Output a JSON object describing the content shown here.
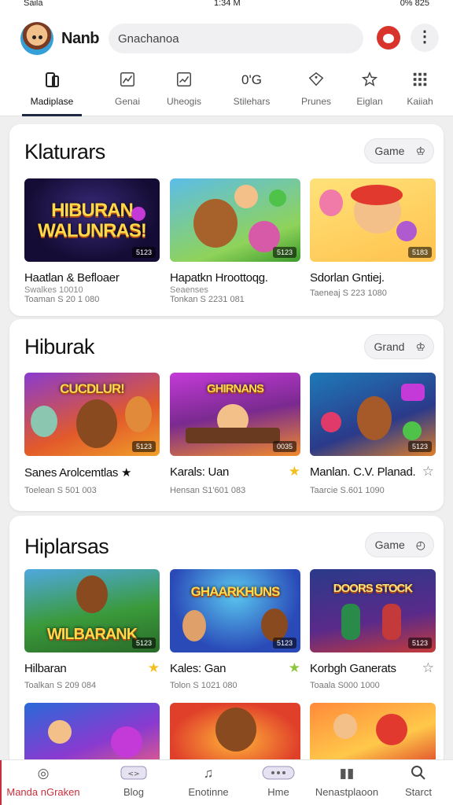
{
  "status": {
    "carrier": "Saila",
    "time": "1:34 M",
    "battery": "0%  825"
  },
  "header": {
    "app_name": "Nanb",
    "search_value": "Gnachanoa"
  },
  "tabs": [
    {
      "label": "Madiplase",
      "icon": "phone-icon",
      "active": true
    },
    {
      "label": "Genai",
      "icon": "chart-icon"
    },
    {
      "label": "Uheogis",
      "icon": "trend-icon"
    },
    {
      "label": "Stilehars",
      "icon": "text-icon",
      "glyph": "0'G"
    },
    {
      "label": "Prunes",
      "icon": "tag-icon"
    },
    {
      "label": "Eiglan",
      "icon": "star-icon"
    },
    {
      "label": "Kaiiah",
      "icon": "grid-icon"
    }
  ],
  "sections": [
    {
      "title": "Klaturars",
      "button": "Game",
      "button_icon": "crown-icon",
      "cards": [
        {
          "title": "Haatlan & Befloaer",
          "sub": "Swalkes 10010",
          "meta": "Toaman  S 20 1 080",
          "badge": "5123",
          "art_text": "HIBURAN WALUNRAS!"
        },
        {
          "title": "Hapatkn Hroottoqg.",
          "sub": "Seaenses",
          "meta": "Tonkan  S 2231 081",
          "badge": "5123"
        },
        {
          "title": "Sdorlan Gntiej.",
          "sub": "",
          "meta": "Taeneaj  S 223 1080",
          "badge": "5183"
        }
      ]
    },
    {
      "title": "Hiburak",
      "button": "Grand",
      "button_icon": "crown-icon",
      "cards": [
        {
          "title": "Sanes  Arolcemtlas ★",
          "meta": "Toelean  S 501 003",
          "badge": "5123",
          "art_text": "CUCDLUR!"
        },
        {
          "title": "Karals: Uan",
          "meta": "Hensan  S1'601 083",
          "badge": "0035",
          "star": "yellow",
          "art_text": "GHIRNANS"
        },
        {
          "title": "Manlan. C.V. Planad.",
          "meta": "Taarcie  S.601 1090",
          "badge": "5123",
          "star": "outline"
        }
      ]
    },
    {
      "title": "Hiplarsas",
      "button": "Game",
      "button_icon": "clock-icon",
      "cards": [
        {
          "title": "Hilbaran",
          "meta": "Toalkan  S 209 084",
          "badge": "5123",
          "star": "yellow",
          "art_text": "WILBARANK"
        },
        {
          "title": "Kales: Gan",
          "meta": "Tolon  S 1021 080",
          "badge": "5123",
          "star": "green",
          "art_text": "GHAARKHUNS"
        },
        {
          "title": "Korbgh Ganerats",
          "meta": "Toaala  S000 1000",
          "badge": "5123",
          "star": "outline",
          "art_text": "DOORS STOCK"
        }
      ]
    }
  ],
  "bottom_nav": [
    {
      "label": "Manda  nGraken",
      "icon": "compass-icon",
      "active": true
    },
    {
      "label": "Blog",
      "icon": "controller-icon"
    },
    {
      "label": "Enotinne",
      "icon": "music-icon"
    },
    {
      "label": "Hme",
      "icon": "chat-icon"
    },
    {
      "label": "Nenastplaoon",
      "icon": "store-icon"
    },
    {
      "label": "Starct",
      "icon": "search-icon"
    }
  ],
  "colors": {
    "accent": "#c8303c",
    "tab_indicator": "#1e2a44",
    "star_yellow": "#f4c020",
    "star_green": "#8cc63f"
  }
}
